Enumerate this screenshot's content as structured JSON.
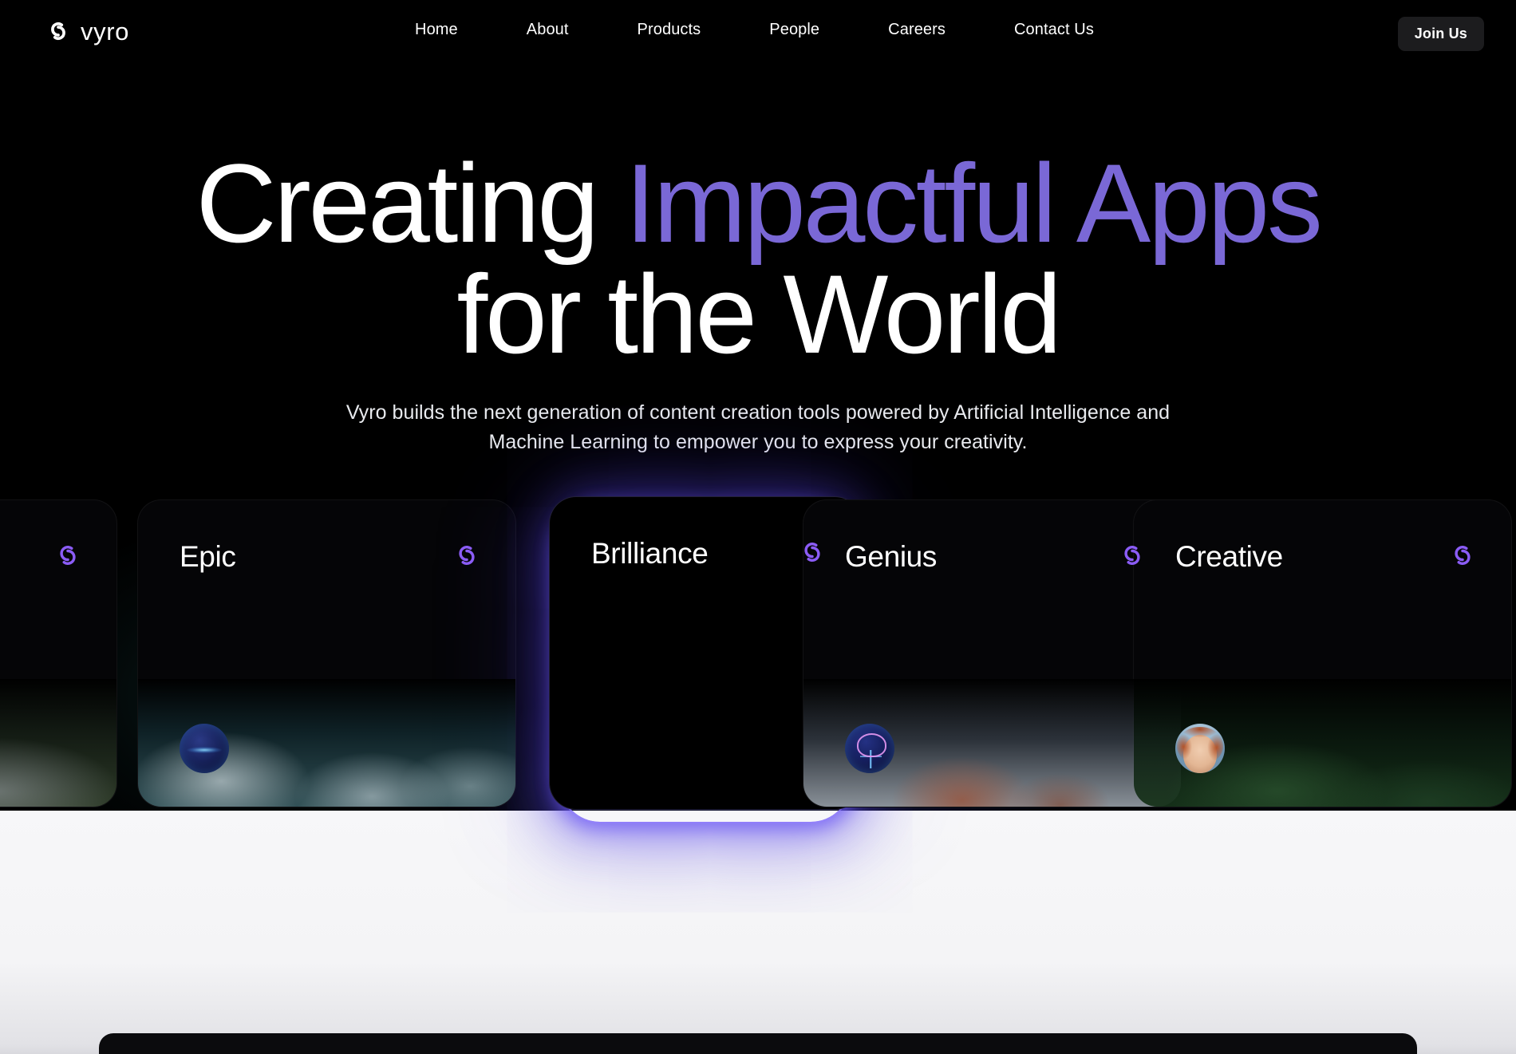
{
  "brand": {
    "name": "vyro",
    "logo_icon": "vyro-swirl-logo-icon",
    "accent_color": "#7a68d6",
    "glow_color": "#6e5af5"
  },
  "nav": {
    "items": [
      {
        "label": "Home"
      },
      {
        "label": "About"
      },
      {
        "label": "Products"
      },
      {
        "label": "People"
      },
      {
        "label": "Careers"
      },
      {
        "label": "Contact Us"
      }
    ],
    "cta": {
      "label": "Join Us"
    }
  },
  "hero": {
    "headline_part1": "Creating ",
    "headline_accent": "Impactful Apps",
    "headline_line2": "for the World",
    "subcopy": "Vyro builds the next generation of content creation tools powered by Artificial Intelligence and Machine Learning to empower you to express your creativity."
  },
  "cards": [
    {
      "title": "",
      "logo_icon": "vyro-swirl-logo-icon",
      "avatar_icon": "forest-photo-icon",
      "featured": false
    },
    {
      "title": "Epic",
      "logo_icon": "vyro-swirl-logo-icon",
      "avatar_icon": "globe-network-icon",
      "featured": false
    },
    {
      "title": "Brilliance",
      "logo_icon": "vyro-swirl-logo-icon",
      "avatar_icon": "",
      "featured": true
    },
    {
      "title": "Genius",
      "logo_icon": "vyro-swirl-logo-icon",
      "avatar_icon": "brain-circuit-icon",
      "featured": false
    },
    {
      "title": "Creative",
      "logo_icon": "vyro-swirl-logo-icon",
      "avatar_icon": "person-portrait-icon",
      "featured": false
    }
  ]
}
